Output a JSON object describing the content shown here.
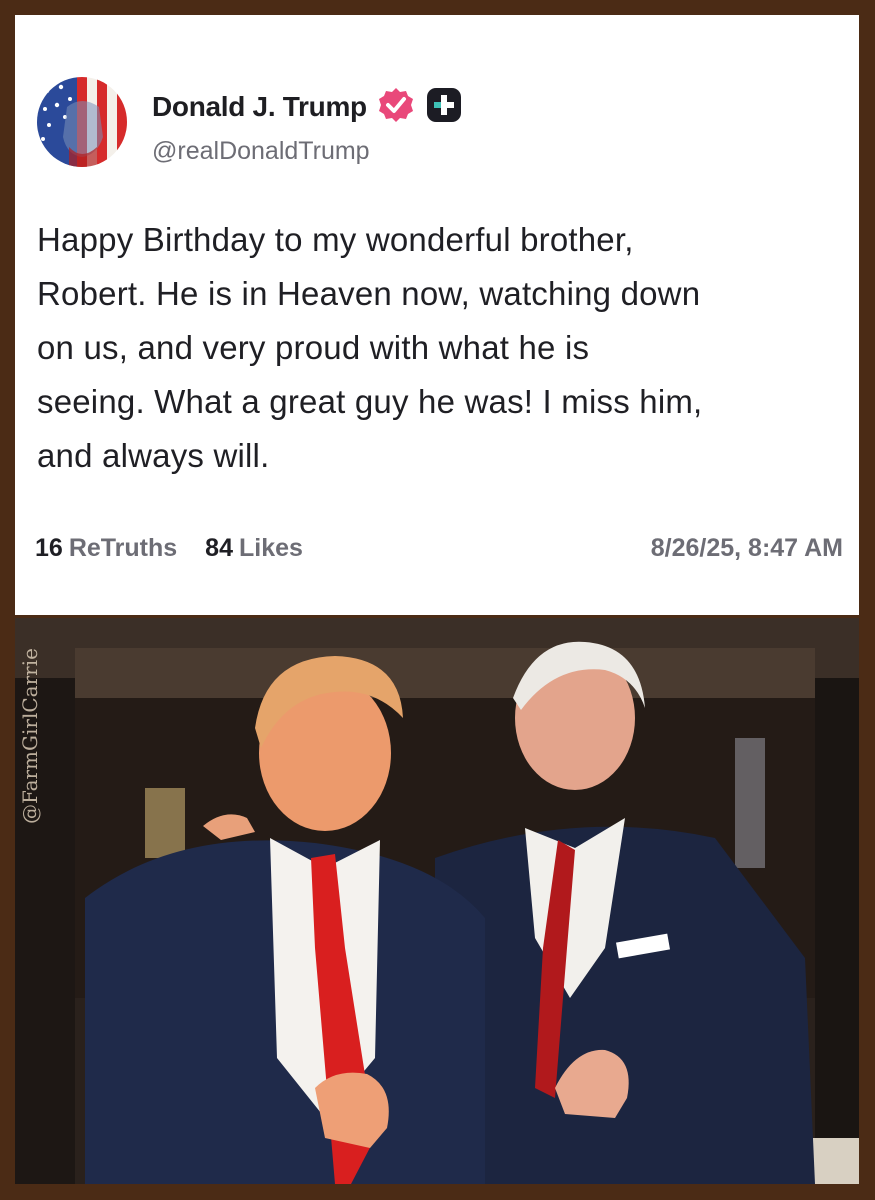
{
  "post": {
    "display_name": "Donald J. Trump",
    "handle": "@realDonaldTrump",
    "text": "Happy Birthday to my wonderful brother,\nRobert. He is in Heaven now, watching down\non us, and very proud with what he is\nseeing. What a great guy he was! I miss him,\nand always will.",
    "retruths_count": "16",
    "retruths_label": "ReTruths",
    "likes_count": "84",
    "likes_label": "Likes",
    "timestamp": "8/26/25, 8:47 AM"
  },
  "icons": {
    "verified": "verified-badge-icon",
    "plus": "plus-subscriber-icon",
    "avatar": "american-flag-portrait"
  },
  "colors": {
    "verified_badge": "#e9487a",
    "frame": "#4b2b15",
    "tie_red": "#d41f1f",
    "suit_navy": "#1c2540"
  },
  "photo": {
    "watermark": "@FarmGirlCarrie"
  }
}
